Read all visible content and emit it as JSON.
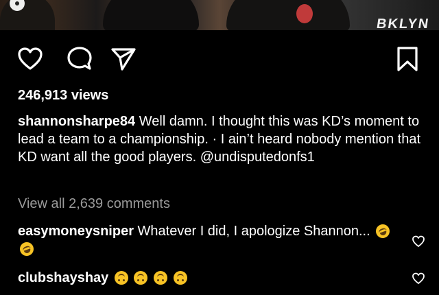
{
  "media": {
    "watermark_text": "BKLYN"
  },
  "actions": {
    "like_icon": "heart-icon",
    "comment_icon": "comment-bubble-icon",
    "share_icon": "paper-plane-icon",
    "save_icon": "bookmark-icon"
  },
  "post": {
    "views": "246,913 views",
    "caption_user": "shannonsharpe84",
    "caption_text": "Well damn. I thought this was KD’s moment to lead a team to a championship. · I ain’t heard nobody mention that KD want all the good players. @undisputedonfs1",
    "view_all_comments": "View all 2,639 comments"
  },
  "comments": [
    {
      "user": "easymoneysniper",
      "text": "Whatever I did, I apologize Shannon...",
      "emojis": [
        "rolling-on-floor-laughing-emoji",
        "rolling-on-floor-laughing-emoji"
      ]
    },
    {
      "user": "clubshayshay",
      "text": "",
      "emojis": [
        "upside-down-face-emoji",
        "upside-down-face-emoji",
        "upside-down-face-emoji",
        "upside-down-face-emoji"
      ]
    }
  ],
  "colors": {
    "background": "#000000",
    "text": "#ffffff",
    "muted": "#9a9a9a",
    "emoji_yellow": "#f7c325"
  }
}
